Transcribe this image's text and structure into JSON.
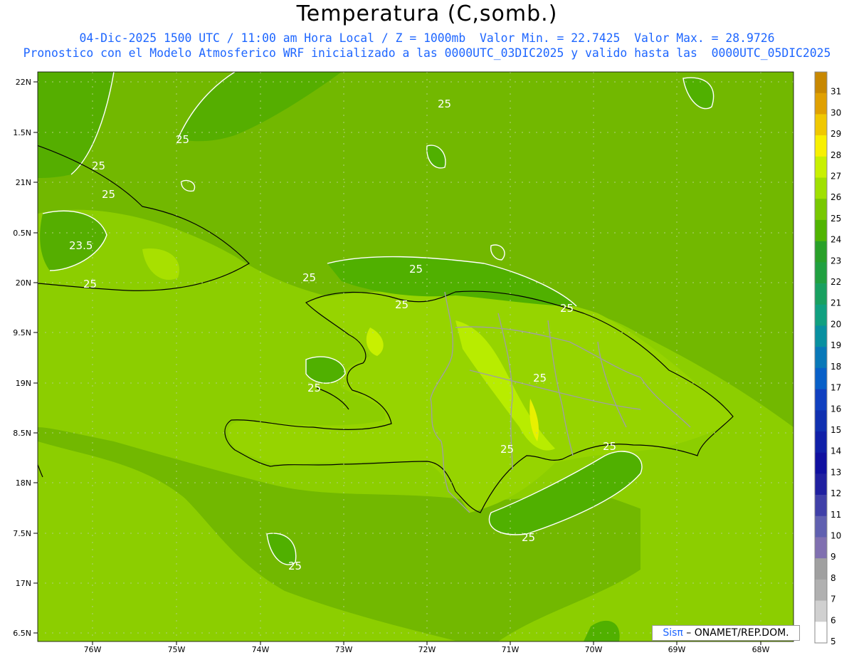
{
  "header": {
    "title": "Temperatura (C,somb.)",
    "line1": "04-Dic-2025 1500 UTC / 11:00 am Hora Local / Z = 1000mb  Valor Min. = 22.7425  Valor Max. = 28.9726",
    "line2": "Pronostico con el Modelo Atmosferico WRF inicializado a las 0000UTC_03DIC2025 y valido hasta las  0000UTC_05DIC2025"
  },
  "axes": {
    "lat_labels": [
      "22N",
      "1.5N",
      "21N",
      "0.5N",
      "20N",
      "9.5N",
      "19N",
      "8.5N",
      "18N",
      "7.5N",
      "17N",
      "6.5N"
    ],
    "lon_labels": [
      "76W",
      "75W",
      "74W",
      "73W",
      "72W",
      "71W",
      "70W",
      "69W",
      "68W"
    ]
  },
  "contour_labels": [
    "25",
    "25",
    "25",
    "25",
    "23.5",
    "25",
    "25",
    "25",
    "25",
    "25",
    "25",
    "25",
    "25",
    "25",
    "25",
    "25"
  ],
  "colorbar": {
    "ticks": [
      "31",
      "30",
      "29",
      "28",
      "27",
      "26",
      "25",
      "24",
      "23",
      "22",
      "21",
      "20",
      "19",
      "18",
      "17",
      "16",
      "15",
      "14",
      "13",
      "12",
      "11",
      "10",
      "9",
      "8",
      "7",
      "6",
      "5"
    ],
    "colors": [
      "#c88800",
      "#e0a000",
      "#f0c800",
      "#f8f000",
      "#c8f000",
      "#a0e000",
      "#78c800",
      "#50b400",
      "#28a028",
      "#20a040",
      "#18a060",
      "#10a080",
      "#0890a0",
      "#0878b8",
      "#0860c8",
      "#1040c0",
      "#1030b0",
      "#1020a8",
      "#1010a0",
      "#2020a0",
      "#4040a8",
      "#6060b0",
      "#8070b0",
      "#a0a0a0",
      "#b0b0b0",
      "#d0d0d0",
      "#ffffff"
    ]
  },
  "credit": {
    "brand": "Sisπ",
    "text": " – ONAMET/REP.DOM."
  }
}
